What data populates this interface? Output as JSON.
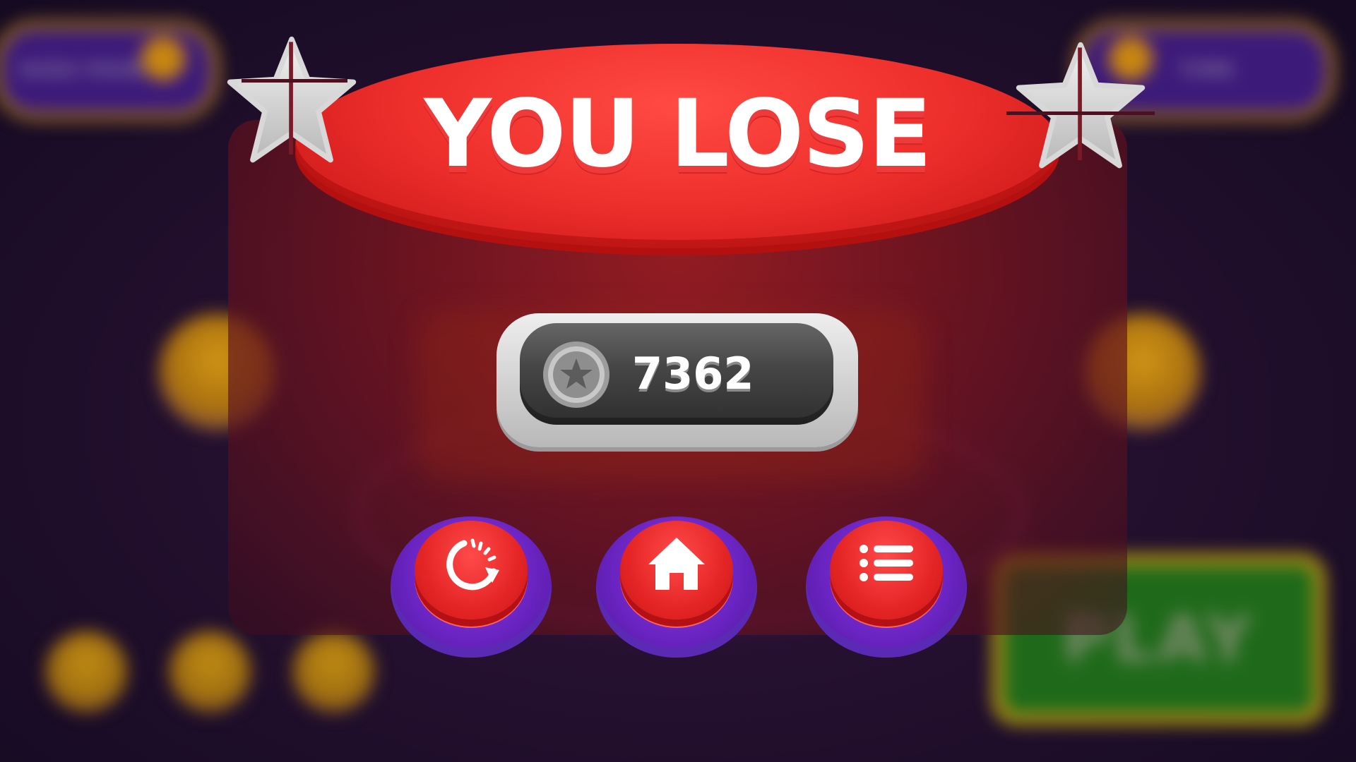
{
  "background": {
    "top_left_pill_text": "HIGH POINT",
    "top_right_pill_text": "TIME",
    "play_label": "PLAY"
  },
  "result": {
    "title": "YOU LOSE",
    "score": "7362"
  },
  "actions": [
    {
      "name": "restart",
      "icon": "restart-arrow-icon"
    },
    {
      "name": "home",
      "icon": "home-icon"
    },
    {
      "name": "menu",
      "icon": "list-menu-icon"
    }
  ],
  "colors": {
    "banner_red": "#ee2f2c",
    "button_purple": "#6a24c2",
    "button_red": "#e52525",
    "score_bar_dark": "#454545",
    "play_green": "#1f6a1a",
    "gold_border": "#b4810e"
  }
}
